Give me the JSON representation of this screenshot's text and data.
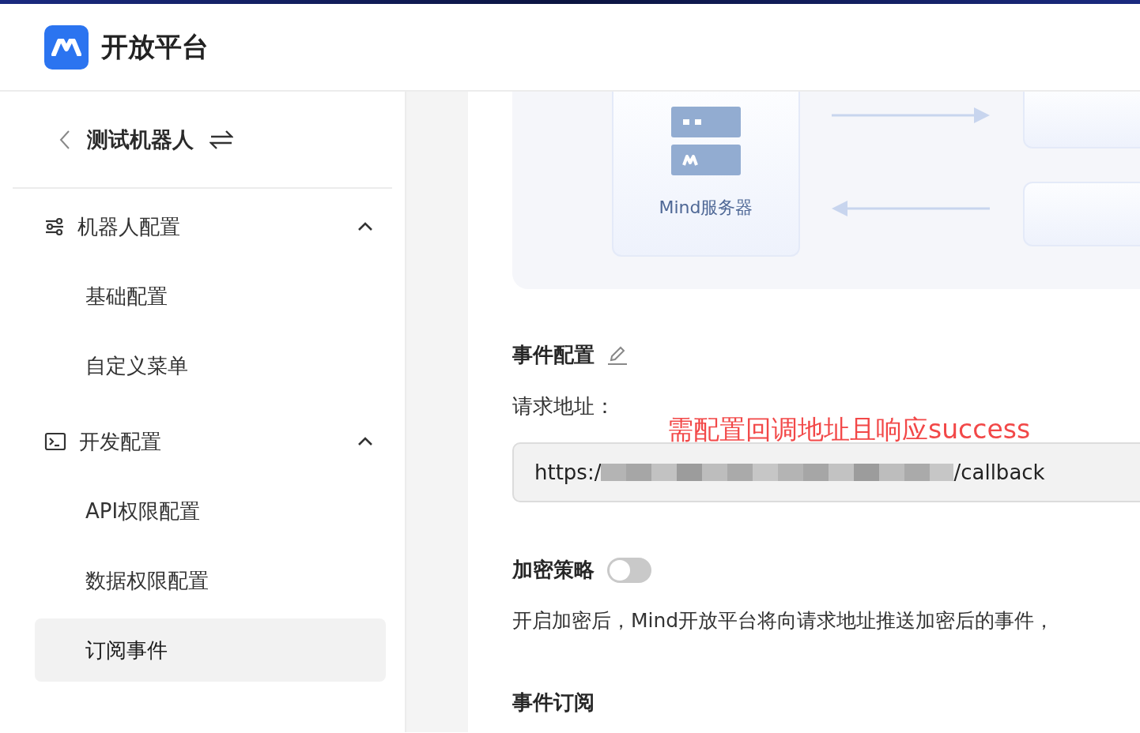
{
  "header": {
    "title": "开放平台"
  },
  "sidebar": {
    "bot_name": "测试机器人",
    "groups": [
      {
        "label": "机器人配置",
        "kind": "sliders",
        "expanded": true,
        "items": [
          {
            "label": "基础配置",
            "selected": false
          },
          {
            "label": "自定义菜单",
            "selected": false
          }
        ]
      },
      {
        "label": "开发配置",
        "kind": "terminal",
        "expanded": true,
        "items": [
          {
            "label": "API权限配置",
            "selected": false
          },
          {
            "label": "数据权限配置",
            "selected": false
          },
          {
            "label": "订阅事件",
            "selected": true
          }
        ]
      }
    ]
  },
  "diagram": {
    "server_label": "Mind服务器"
  },
  "event_config": {
    "title": "事件配置",
    "request_url_label": "请求地址：",
    "annotation": "需配置回调地址且响应success",
    "url_start": "https:/",
    "url_end": "/callback"
  },
  "encryption": {
    "title": "加密策略",
    "on": false,
    "description": "开启加密后，Mind开放平台将向请求地址推送加密后的事件，"
  },
  "event_subscription": {
    "title": "事件订阅"
  }
}
